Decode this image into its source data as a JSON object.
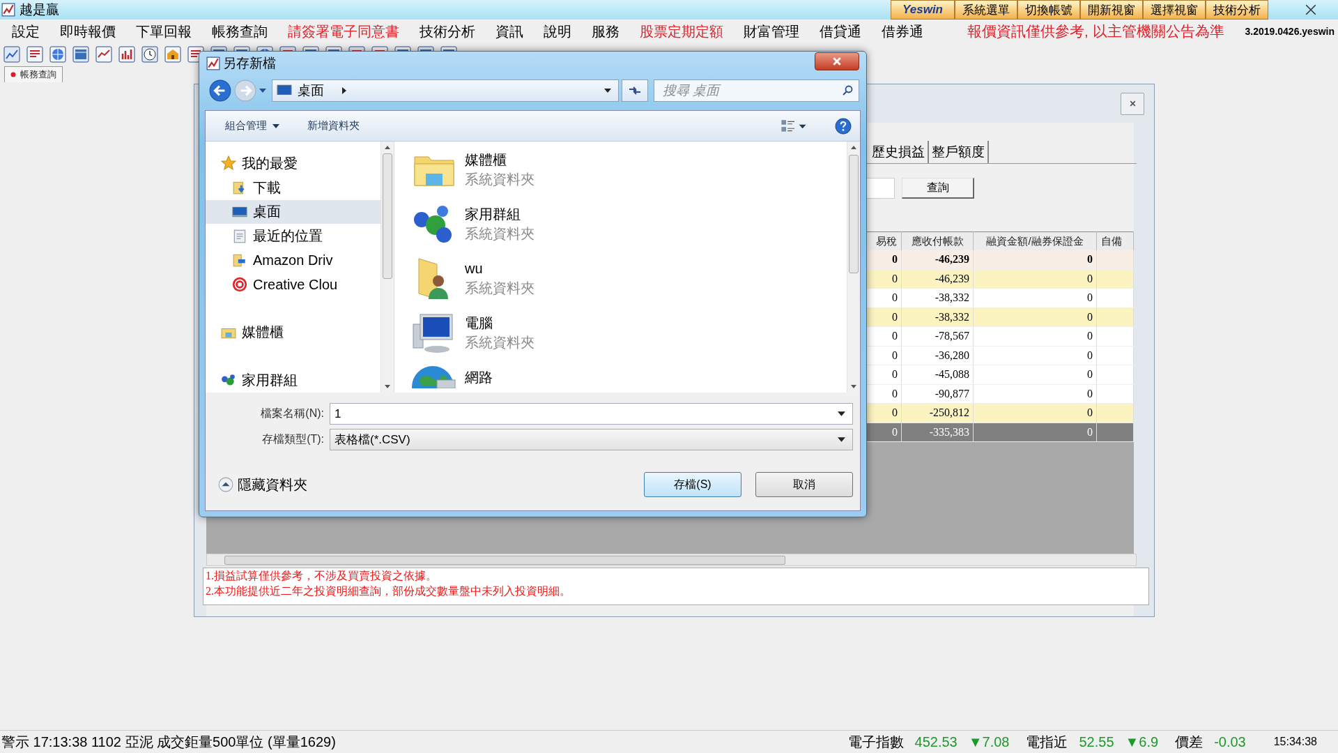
{
  "app_window": {
    "title": "越是贏",
    "logo": "Yeswin",
    "top_buttons": [
      "系統選單",
      "切換帳號",
      "開新視窗",
      "選擇視窗",
      "技術分析"
    ]
  },
  "menu": [
    {
      "label": "設定",
      "emphasized": false
    },
    {
      "label": "即時報價",
      "emphasized": false
    },
    {
      "label": "下單回報",
      "emphasized": false
    },
    {
      "label": "帳務查詢",
      "emphasized": false
    },
    {
      "label": "請簽署電子同意書",
      "emphasized": true
    },
    {
      "label": "技術分析",
      "emphasized": false
    },
    {
      "label": "資訊",
      "emphasized": false
    },
    {
      "label": "說明",
      "emphasized": false
    },
    {
      "label": "服務",
      "emphasized": false
    },
    {
      "label": "股票定期定額",
      "emphasized": true
    },
    {
      "label": "財富管理",
      "emphasized": false
    },
    {
      "label": "借貸通",
      "emphasized": false
    },
    {
      "label": "借券通",
      "emphasized": false
    }
  ],
  "notice": "報價資訊僅供參考, 以主管機關公告為準",
  "version": "3.2019.0426.yeswin",
  "doc_tab": "帳務查詢",
  "child_window": {
    "tabs": [
      {
        "label": "歷史損益",
        "selected": false
      },
      {
        "label": "整戶額度",
        "selected": false
      }
    ],
    "query_button": "查詢",
    "table": {
      "columns": [
        "易稅",
        "應收付帳款",
        "融資金額/融券保證金",
        "自備"
      ],
      "rows": [
        {
          "kind": "total",
          "cells": [
            "0",
            "-46,239",
            "0"
          ]
        },
        {
          "kind": "highlight",
          "cells": [
            "0",
            "-46,239",
            "0"
          ]
        },
        {
          "kind": "plain",
          "cells": [
            "0",
            "-38,332",
            "0"
          ]
        },
        {
          "kind": "highlight",
          "cells": [
            "0",
            "-38,332",
            "0"
          ]
        },
        {
          "kind": "plain",
          "cells": [
            "0",
            "-78,567",
            "0"
          ]
        },
        {
          "kind": "plain",
          "cells": [
            "0",
            "-36,280",
            "0"
          ]
        },
        {
          "kind": "plain",
          "cells": [
            "0",
            "-45,088",
            "0"
          ]
        },
        {
          "kind": "plain",
          "cells": [
            "0",
            "-90,877",
            "0"
          ]
        },
        {
          "kind": "highlight",
          "cells": [
            "0",
            "-250,812",
            "0"
          ]
        },
        {
          "kind": "summary",
          "cells": [
            "0",
            "-335,383",
            "0"
          ]
        }
      ]
    },
    "notes": [
      "1.損益試算僅供參考，不涉及買賣投資之依據。",
      "2.本功能提供近二年之投資明細查詢，部份成交數量盤中未列入投資明細。"
    ]
  },
  "dialog": {
    "title": "另存新檔",
    "location": "桌面",
    "search_placeholder": "搜尋 桌面",
    "commands": [
      "組合管理",
      "新增資料夾"
    ],
    "nav": [
      {
        "label": "我的最愛",
        "selected": false,
        "children": [
          {
            "label": "下載",
            "selected": false
          },
          {
            "label": "桌面",
            "selected": true
          },
          {
            "label": "最近的位置",
            "selected": false
          },
          {
            "label": "Amazon Driv",
            "selected": false
          },
          {
            "label": "Creative Clou",
            "selected": false
          }
        ]
      },
      {
        "label": "媒體櫃",
        "selected": false
      },
      {
        "label": "家用群組",
        "selected": false
      }
    ],
    "items": [
      {
        "name": "媒體櫃",
        "type": "系統資料夾"
      },
      {
        "name": "家用群組",
        "type": "系統資料夾"
      },
      {
        "name": "wu",
        "type": "系統資料夾"
      },
      {
        "name": "電腦",
        "type": "系統資料夾"
      },
      {
        "name": "網路"
      }
    ],
    "filename_label": "檔案名稱(N):",
    "filename": "1",
    "filetype_label": "存檔類型(T):",
    "filetype": "表格檔(*.CSV)",
    "hide_folders": "隱藏資料夾",
    "buttons": [
      {
        "label": "存檔(S)",
        "default": true
      },
      {
        "label": "取消",
        "default": false
      }
    ]
  },
  "status_bar": {
    "alert": "警示 17:13:38 1102 亞泥 成交鉅量500單位 (單量1629)",
    "quotes": [
      {
        "label": "電子指數",
        "value": "452.53",
        "change": "▼7.08"
      },
      {
        "label": "電指近",
        "value": "52.55",
        "change": "▼6.9"
      },
      {
        "label": "價差",
        "value": "-0.03"
      }
    ],
    "time": "15:34:38"
  }
}
